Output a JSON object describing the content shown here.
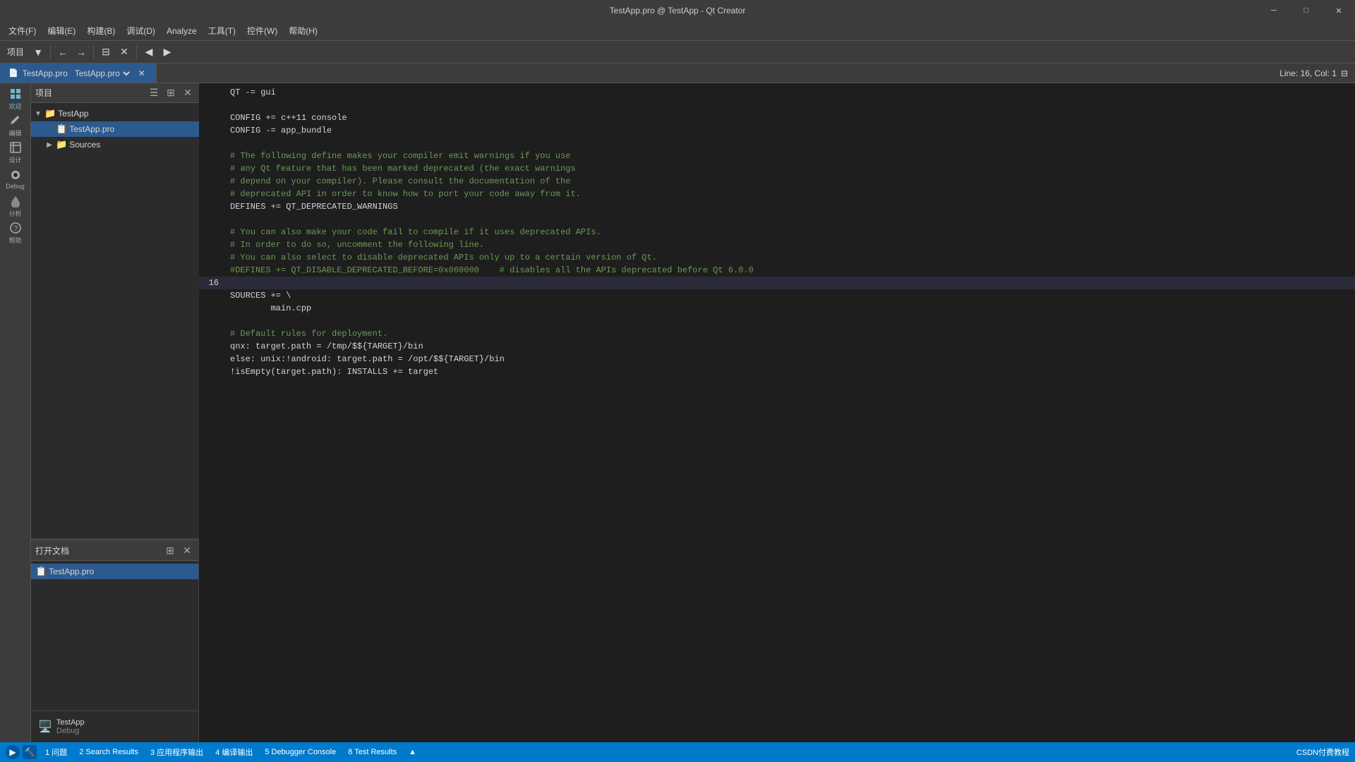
{
  "window": {
    "title": "TestApp.pro @ TestApp - Qt Creator",
    "controls": [
      "minimize",
      "maximize",
      "close"
    ]
  },
  "menu": {
    "items": [
      "文件(F)",
      "编辑(E)",
      "构建(B)",
      "调试(D)",
      "Analyze",
      "工具(T)",
      "控件(W)",
      "帮助(H)"
    ]
  },
  "toolbar": {
    "label": "项目",
    "select_placeholder": "项目"
  },
  "tab": {
    "label": "TestApp.pro",
    "line_col": "Line: 16, Col: 1"
  },
  "sidebar_icons": [
    {
      "name": "welcome",
      "label": "欢迎",
      "symbol": "⊞"
    },
    {
      "name": "edit",
      "label": "编辑",
      "symbol": "✎"
    },
    {
      "name": "design",
      "label": "设计",
      "symbol": "□"
    },
    {
      "name": "debug",
      "label": "Debug",
      "symbol": "🐞"
    },
    {
      "name": "analyze",
      "label": "分析",
      "symbol": "📊"
    },
    {
      "name": "help",
      "label": "帮助",
      "symbol": "?"
    }
  ],
  "project_panel": {
    "title": "项目",
    "tree": [
      {
        "level": 0,
        "label": "TestApp",
        "type": "folder",
        "expanded": true
      },
      {
        "level": 1,
        "label": "TestApp.pro",
        "type": "file",
        "selected": true
      },
      {
        "level": 1,
        "label": "Sources",
        "type": "folder",
        "expanded": false
      }
    ]
  },
  "open_docs_panel": {
    "title": "打开文档",
    "items": [
      {
        "label": "TestApp.pro",
        "selected": true
      }
    ]
  },
  "editor": {
    "code_lines": [
      {
        "num": "",
        "content": "QT -= gui",
        "type": "plain"
      },
      {
        "num": "",
        "content": "",
        "type": "plain"
      },
      {
        "num": "",
        "content": "CONFIG += c++11 console",
        "type": "plain"
      },
      {
        "num": "",
        "content": "CONFIG -= app_bundle",
        "type": "plain"
      },
      {
        "num": "",
        "content": "",
        "type": "plain"
      },
      {
        "num": "",
        "content": "# The following define makes your compiler emit warnings if you use",
        "type": "comment"
      },
      {
        "num": "",
        "content": "# any Qt feature that has been marked deprecated (the exact warnings",
        "type": "comment"
      },
      {
        "num": "",
        "content": "# depend on your compiler). Please consult the documentation of the",
        "type": "comment"
      },
      {
        "num": "",
        "content": "# deprecated API in order to know how to port your code away from it.",
        "type": "comment"
      },
      {
        "num": "",
        "content": "DEFINES += QT_DEPRECATED_WARNINGS",
        "type": "plain"
      },
      {
        "num": "",
        "content": "",
        "type": "plain"
      },
      {
        "num": "",
        "content": "# You can also make your code fail to compile if it uses deprecated APIs.",
        "type": "comment"
      },
      {
        "num": "",
        "content": "# In order to do so, uncomment the following line.",
        "type": "comment"
      },
      {
        "num": "",
        "content": "# You can also select to disable deprecated APIs only up to a certain version of Qt.",
        "type": "comment"
      },
      {
        "num": "",
        "content": "#DEFINES += QT_DISABLE_DEPRECATED_BEFORE=0x060000    # disables all the APIs deprecated before Qt 6.0.0",
        "type": "comment"
      },
      {
        "num": "16",
        "content": "",
        "type": "plain"
      },
      {
        "num": "",
        "content": "SOURCES += \\",
        "type": "plain"
      },
      {
        "num": "",
        "content": "        main.cpp",
        "type": "plain"
      },
      {
        "num": "",
        "content": "",
        "type": "plain"
      },
      {
        "num": "",
        "content": "# Default rules for deployment.",
        "type": "comment"
      },
      {
        "num": "",
        "content": "qnx: target.path = /tmp/$${TARGET}/bin",
        "type": "plain"
      },
      {
        "num": "",
        "content": "else: unix:!android: target.path = /opt/$${TARGET}/bin",
        "type": "plain"
      },
      {
        "num": "",
        "content": "!isEmpty(target.path): INSTALLS += target",
        "type": "plain"
      }
    ]
  },
  "status_bar": {
    "tabs": [
      "1 问题",
      "2 Search Results",
      "3 应用程序输出",
      "4 编译输出",
      "5 Debugger Console",
      "8 Test Results"
    ],
    "debug_label": "Debug",
    "run_icon": "▶",
    "build_icon": "🔨",
    "watermark": "CSDN付费教程"
  },
  "bottom_device": {
    "label": "TestApp",
    "sub_label": "Debug"
  }
}
